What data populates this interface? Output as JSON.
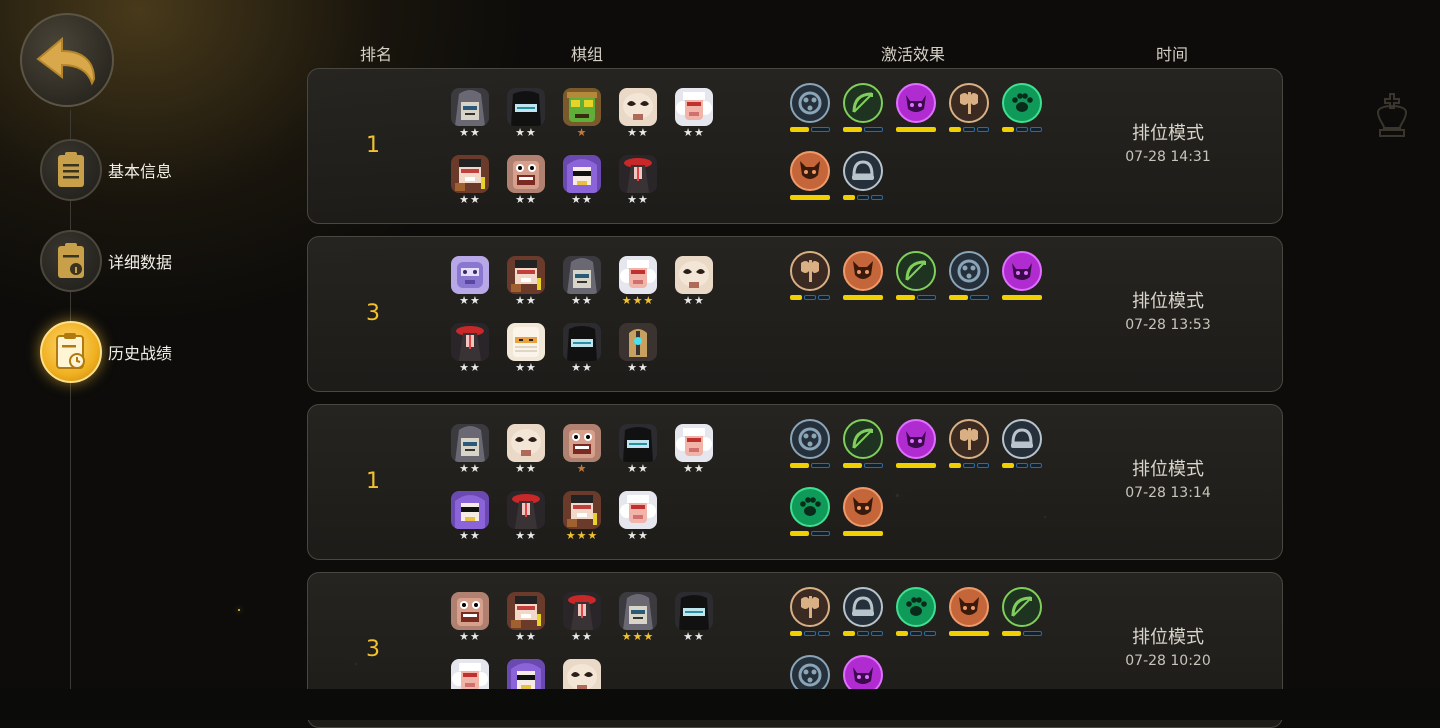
{
  "colors": {
    "accent": "#f2c12e",
    "bar_active": "#f0d000",
    "bar_inactive": "#2f6a9c",
    "card_bg": "#26241f"
  },
  "back": {
    "icon": "back-arrow-icon"
  },
  "nav": [
    {
      "label": "基本信息",
      "icon": "clipboard-icon",
      "active": false
    },
    {
      "label": "详细数据",
      "icon": "data-sheet-icon",
      "active": false
    },
    {
      "label": "历史战绩",
      "icon": "history-clock-icon",
      "active": true
    }
  ],
  "headers": {
    "rank": "排名",
    "lineup": "棋组",
    "traits": "激活效果",
    "time": "时间"
  },
  "matches": [
    {
      "rank": "1",
      "mode": "排位模式",
      "time": "07-28 14:31",
      "pieces": [
        {
          "face": "hooded",
          "stars": "★★",
          "tier": "silver"
        },
        {
          "face": "ninja",
          "stars": "★★",
          "tier": "silver"
        },
        {
          "face": "goblin",
          "stars": "★",
          "tier": "bronze"
        },
        {
          "face": "skull",
          "stars": "★★",
          "tier": "silver"
        },
        {
          "face": "sheep",
          "stars": "★★",
          "tier": "silver"
        },
        {
          "face": "cowboy",
          "stars": "★★",
          "tier": "silver"
        },
        {
          "face": "brute",
          "stars": "★★",
          "tier": "silver"
        },
        {
          "face": "purple",
          "stars": "★★",
          "tier": "silver"
        },
        {
          "face": "redhat",
          "stars": "★★",
          "tier": "silver"
        }
      ],
      "traits": [
        {
          "icon": "shadow-icon",
          "segments": 2,
          "active": 1
        },
        {
          "icon": "bow-icon",
          "segments": 2,
          "active": 1
        },
        {
          "icon": "demon-icon",
          "segments": 1,
          "active": 1
        },
        {
          "icon": "axe-icon",
          "segments": 3,
          "active": 1
        },
        {
          "icon": "paw-icon",
          "segments": 3,
          "active": 1
        },
        {
          "icon": "fox-icon",
          "segments": 1,
          "active": 1
        },
        {
          "icon": "helm-icon",
          "segments": 3,
          "active": 1
        }
      ]
    },
    {
      "rank": "3",
      "mode": "排位模式",
      "time": "07-28 13:53",
      "pieces": [
        {
          "face": "robot",
          "stars": "★★",
          "tier": "silver"
        },
        {
          "face": "cowboy",
          "stars": "★★",
          "tier": "silver"
        },
        {
          "face": "hooded",
          "stars": "★★",
          "tier": "silver"
        },
        {
          "face": "sheep",
          "stars": "★★★",
          "tier": "gold"
        },
        {
          "face": "skull",
          "stars": "★★",
          "tier": "silver"
        },
        {
          "face": "redhat",
          "stars": "★★",
          "tier": "silver"
        },
        {
          "face": "mummy",
          "stars": "★★",
          "tier": "silver"
        },
        {
          "face": "ninja",
          "stars": "★★",
          "tier": "silver"
        },
        {
          "face": "knight",
          "stars": "★★",
          "tier": "silver"
        }
      ],
      "traits": [
        {
          "icon": "axe-icon",
          "segments": 3,
          "active": 1
        },
        {
          "icon": "fox-icon",
          "segments": 1,
          "active": 1
        },
        {
          "icon": "bow-icon",
          "segments": 2,
          "active": 1
        },
        {
          "icon": "shadow-icon",
          "segments": 2,
          "active": 1
        },
        {
          "icon": "demon-icon",
          "segments": 1,
          "active": 1
        }
      ]
    },
    {
      "rank": "1",
      "mode": "排位模式",
      "time": "07-28 13:14",
      "pieces": [
        {
          "face": "hooded",
          "stars": "★★",
          "tier": "silver"
        },
        {
          "face": "skull",
          "stars": "★★",
          "tier": "silver"
        },
        {
          "face": "brute",
          "stars": "★",
          "tier": "bronze"
        },
        {
          "face": "ninja",
          "stars": "★★",
          "tier": "silver"
        },
        {
          "face": "sheep",
          "stars": "★★",
          "tier": "silver"
        },
        {
          "face": "purple",
          "stars": "★★",
          "tier": "silver"
        },
        {
          "face": "redhat",
          "stars": "★★",
          "tier": "silver"
        },
        {
          "face": "cowboy",
          "stars": "★★★",
          "tier": "gold"
        },
        {
          "face": "sheep",
          "stars": "★★",
          "tier": "silver"
        }
      ],
      "traits": [
        {
          "icon": "shadow-icon",
          "segments": 2,
          "active": 1
        },
        {
          "icon": "bow-icon",
          "segments": 2,
          "active": 1
        },
        {
          "icon": "demon-icon",
          "segments": 1,
          "active": 1
        },
        {
          "icon": "axe-icon",
          "segments": 3,
          "active": 1
        },
        {
          "icon": "helm-icon",
          "segments": 3,
          "active": 1
        },
        {
          "icon": "paw-icon",
          "segments": 2,
          "active": 1
        },
        {
          "icon": "fox-icon",
          "segments": 1,
          "active": 1
        }
      ]
    },
    {
      "rank": "3",
      "mode": "排位模式",
      "time": "07-28 10:20",
      "pieces": [
        {
          "face": "brute",
          "stars": "★★",
          "tier": "silver"
        },
        {
          "face": "cowboy",
          "stars": "★★",
          "tier": "silver"
        },
        {
          "face": "redhat",
          "stars": "★★",
          "tier": "silver"
        },
        {
          "face": "hooded",
          "stars": "★★★",
          "tier": "gold"
        },
        {
          "face": "ninja",
          "stars": "★★",
          "tier": "silver"
        },
        {
          "face": "sheep",
          "stars": "",
          "tier": "silver"
        },
        {
          "face": "purple",
          "stars": "",
          "tier": "silver"
        },
        {
          "face": "skull",
          "stars": "",
          "tier": "silver"
        }
      ],
      "traits": [
        {
          "icon": "axe-icon",
          "segments": 3,
          "active": 1
        },
        {
          "icon": "helm-icon",
          "segments": 3,
          "active": 1
        },
        {
          "icon": "paw-icon",
          "segments": 3,
          "active": 1
        },
        {
          "icon": "fox-icon",
          "segments": 1,
          "active": 1
        },
        {
          "icon": "bow-icon",
          "segments": 2,
          "active": 1
        },
        {
          "icon": "shadow-icon",
          "segments": 2,
          "active": 0
        },
        {
          "icon": "demon-icon",
          "segments": 1,
          "active": 0
        }
      ]
    }
  ]
}
